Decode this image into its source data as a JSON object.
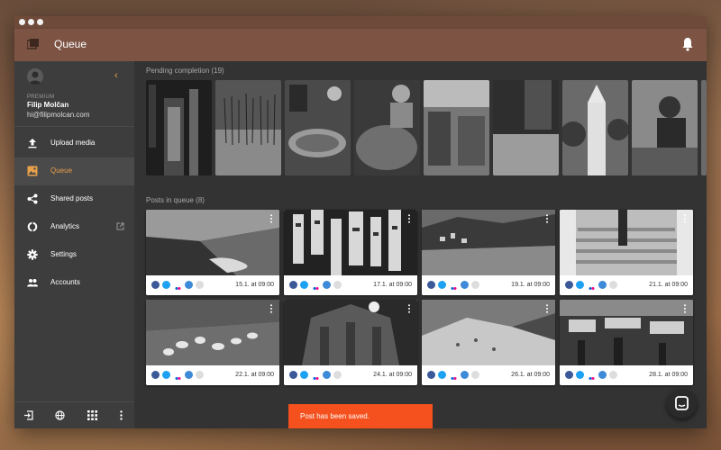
{
  "app": {
    "title": "Queue"
  },
  "user": {
    "plan": "PREMIUM",
    "name": "Filip Molčan",
    "email": "hi@filipmolcan.com"
  },
  "nav": [
    {
      "label": "Upload media",
      "icon": "upload-icon"
    },
    {
      "label": "Queue",
      "icon": "image-icon",
      "active": true
    },
    {
      "label": "Shared posts",
      "icon": "share-icon"
    },
    {
      "label": "Analytics",
      "icon": "analytics-icon"
    },
    {
      "label": "Settings",
      "icon": "gear-icon"
    },
    {
      "label": "Accounts",
      "icon": "people-icon"
    }
  ],
  "pending": {
    "label": "Pending completion (19)"
  },
  "queue": {
    "label": "Posts in queue (8)",
    "posts": [
      {
        "when": "15.1. at 09:00"
      },
      {
        "when": "17.1. at 09:00"
      },
      {
        "when": "19.1. at 09:00"
      },
      {
        "when": "21.1. at 09:00"
      },
      {
        "when": "22.1. at 09:00"
      },
      {
        "when": "24.1. at 09:00"
      },
      {
        "when": "26.1. at 09:00"
      },
      {
        "when": "28.1. at 09:00"
      }
    ]
  },
  "toast": {
    "message": "Post has been saved."
  },
  "colors": {
    "accent": "#e8a04a",
    "toast": "#f4511e",
    "appbar": "#7d5444"
  }
}
